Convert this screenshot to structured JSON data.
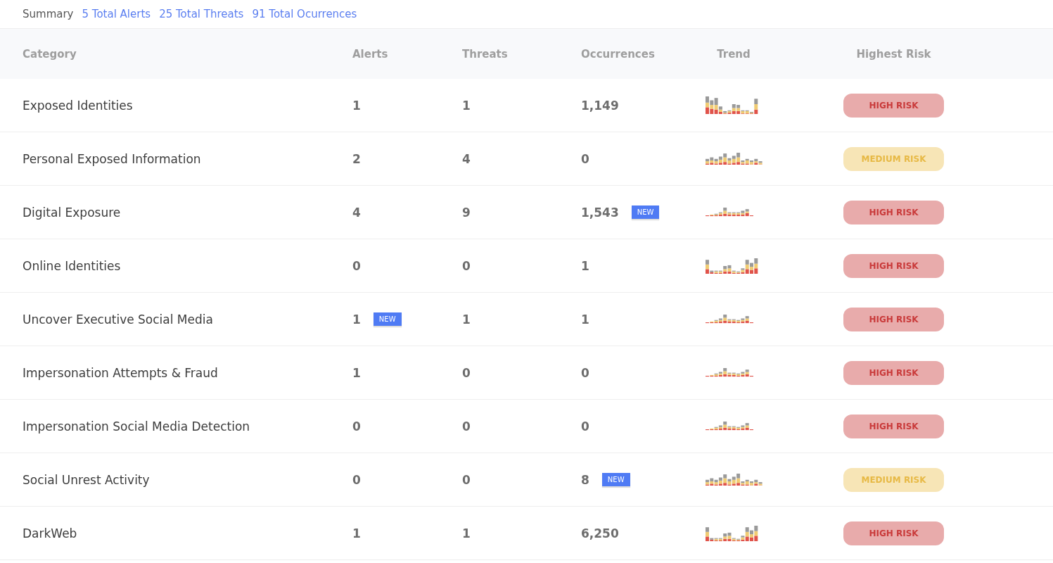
{
  "summary": {
    "label": "Summary",
    "links": [
      "5 Total Alerts",
      "25 Total Threats",
      "91 Total Ocurrences"
    ]
  },
  "table": {
    "columns": [
      "Category",
      "Alerts",
      "Threats",
      "Occurrences",
      "Trend",
      "Highest Risk"
    ],
    "rows": [
      {
        "category": "Exposed Identities",
        "alerts": "1",
        "threats": "1",
        "occurrences": "1,149",
        "risk": {
          "kind": "high",
          "label": "HIGH RISK"
        }
      },
      {
        "category": "Personal Exposed Information",
        "alerts": "2",
        "threats": "4",
        "occurrences": "0",
        "risk": {
          "kind": "medium",
          "label": "MEDIUM RISK"
        }
      },
      {
        "category": "Digital Exposure",
        "alerts": "4",
        "threats": "9",
        "occurrences": "1,543",
        "occurrences_badge": "NEW",
        "risk": {
          "kind": "high",
          "label": "HIGH RISK"
        }
      },
      {
        "category": "Online Identities",
        "alerts": "0",
        "threats": "0",
        "occurrences": "1",
        "risk": {
          "kind": "high",
          "label": "HIGH RISK"
        }
      },
      {
        "category": "Uncover Executive Social Media",
        "alerts": "1",
        "alerts_badge": "NEW",
        "threats": "1",
        "occurrences": "1",
        "risk": {
          "kind": "high",
          "label": "HIGH RISK"
        }
      },
      {
        "category": "Impersonation Attempts & Fraud",
        "alerts": "1",
        "threats": "0",
        "occurrences": "0",
        "risk": {
          "kind": "high",
          "label": "HIGH RISK"
        }
      },
      {
        "category": "Impersonation Social Media Detection",
        "alerts": "0",
        "threats": "0",
        "occurrences": "0",
        "risk": {
          "kind": "high",
          "label": "HIGH RISK"
        }
      },
      {
        "category": "Social Unrest Activity",
        "alerts": "0",
        "threats": "0",
        "occurrences": "8",
        "occurrences_badge": "NEW",
        "risk": {
          "kind": "medium",
          "label": "MEDIUM RISK"
        }
      },
      {
        "category": "DarkWeb",
        "alerts": "1",
        "threats": "1",
        "occurrences": "6,250",
        "risk": {
          "kind": "high",
          "label": "HIGH RISK"
        }
      }
    ]
  }
}
